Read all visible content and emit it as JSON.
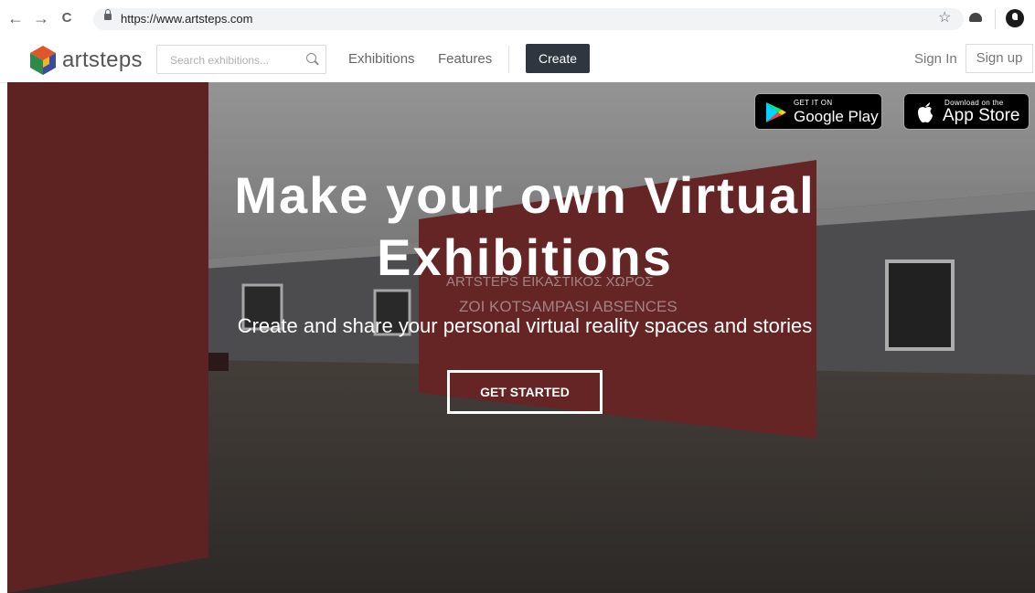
{
  "browser": {
    "url": "https://www.artsteps.com",
    "back_glyph": "←",
    "forward_glyph": "→",
    "reload_glyph": "C",
    "bookmark_glyph": "☆"
  },
  "header": {
    "brand": "artsteps",
    "search_placeholder": "Search exhibitions...",
    "nav": [
      "Exhibitions",
      "Features"
    ],
    "create_label": "Create",
    "sign_in": "Sign In",
    "sign_up": "Sign up"
  },
  "hero": {
    "title": "Make your own Virtual Exhibitions",
    "subtitle": "Create and share your personal virtual reality spaces and stories",
    "cta": "GET STARTED",
    "gallery_sign_line1": "ARTSTEPS ΕΙΚΑΣΤΙΚΟΣ ΧΩΡΟΣ",
    "gallery_sign_line2": "ZOI KOTSAMPASI ABSENCES"
  },
  "badges": {
    "google_small": "GET IT ON",
    "google_big": "Google Play",
    "apple_small": "Download on the",
    "apple_big": "App Store"
  },
  "icons": [
    "back-arrow-icon",
    "forward-arrow-icon",
    "reload-icon",
    "lock-icon",
    "star-icon",
    "cloud-extension-icon",
    "account-extension-icon",
    "artsteps-logo-icon",
    "search-icon",
    "google-play-icon",
    "apple-icon"
  ],
  "colors": {
    "create_button": "#2f3640",
    "gallery_wall_red": "#7a2424"
  }
}
